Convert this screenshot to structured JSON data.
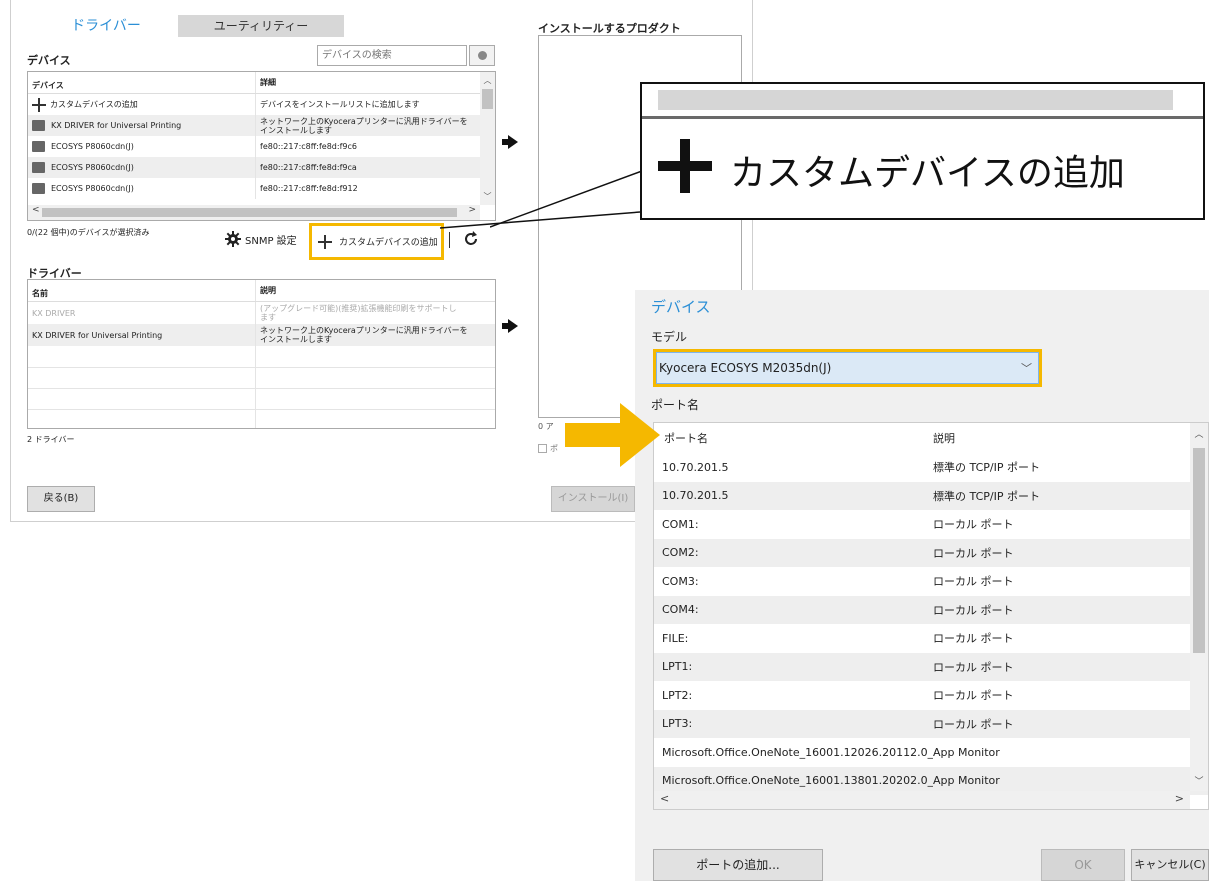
{
  "main": {
    "tabs": {
      "drivers": "ドライバー",
      "utility": "ユーティリティー"
    },
    "devices_title": "デバイス",
    "search_placeholder": "デバイスの検索",
    "device_grid": {
      "col_device": "デバイス",
      "col_detail": "詳細",
      "rows": [
        {
          "name": "カスタムデバイスの追加",
          "detail": "デバイスをインストールリストに追加します",
          "icon": "plus-icon"
        },
        {
          "name": "KX DRIVER for Universal Printing",
          "detail": "ネットワーク上のKyoceraプリンターに汎用ドライバーを\nインストールします",
          "icon": "folder-icon"
        },
        {
          "name": "ECOSYS P8060cdn(J)",
          "detail": "fe80::217:c8ff:fe8d:f9c6",
          "icon": "folder-icon"
        },
        {
          "name": "ECOSYS P8060cdn(J)",
          "detail": "fe80::217:c8ff:fe8d:f9ca",
          "icon": "folder-icon"
        },
        {
          "name": "ECOSYS P8060cdn(J)",
          "detail": "fe80::217:c8ff:fe8d:f912",
          "icon": "folder-icon"
        }
      ]
    },
    "selected_status": "0/(22 個中)のデバイスが選択済み",
    "snmp_label": "SNMP 設定",
    "add_custom_label": "カスタムデバイスの追加",
    "drivers_title": "ドライバー",
    "driver_grid": {
      "col_name": "名前",
      "col_desc": "説明",
      "rows": [
        {
          "name": "KX DRIVER",
          "desc": "(アップグレード可能)(推奨)拡張機能印刷をサポートし\nます",
          "muted": true
        },
        {
          "name": "KX DRIVER for Universal Printing",
          "desc": "ネットワーク上のKyoceraプリンターに汎用ドライバーを\nインストールします",
          "muted": false
        }
      ]
    },
    "driver_count": "2 ドライバー",
    "back_button": "戻る(B)",
    "install_products_title": "インストールするプロダクト",
    "install_button": "インストール(I)",
    "partial_count": "0 ア",
    "partial_checkbox": "ポ"
  },
  "callout": {
    "label": "カスタムデバイスの追加"
  },
  "dialog": {
    "title": "デバイス",
    "model_label": "モデル",
    "model_value": "Kyocera ECOSYS M2035dn(J)",
    "port_label": "ポート名",
    "col_port": "ポート名",
    "col_desc": "説明",
    "ports": [
      {
        "name": "10.70.201.5",
        "desc": "標準の TCP/IP ポート"
      },
      {
        "name": "10.70.201.5",
        "desc": "標準の TCP/IP ポート"
      },
      {
        "name": "COM1:",
        "desc": "ローカル ポート"
      },
      {
        "name": "COM2:",
        "desc": "ローカル ポート"
      },
      {
        "name": "COM3:",
        "desc": "ローカル ポート"
      },
      {
        "name": "COM4:",
        "desc": "ローカル ポート"
      },
      {
        "name": "FILE:",
        "desc": "ローカル ポート"
      },
      {
        "name": "LPT1:",
        "desc": "ローカル ポート"
      },
      {
        "name": "LPT2:",
        "desc": "ローカル ポート"
      },
      {
        "name": "LPT3:",
        "desc": "ローカル ポート"
      },
      {
        "name": "Microsoft.Office.OneNote_16001.12026.20112.0_...",
        "desc": "App Monitor"
      },
      {
        "name": "Microsoft.Office.OneNote_16001.13801.20202.0_...",
        "desc": "App Monitor"
      }
    ],
    "add_port_button": "ポートの追加...",
    "ok_button": "OK",
    "cancel_button": "キャンセル(C)"
  },
  "colors": {
    "accent": "#2b8fd6",
    "highlight": "#f5b800"
  }
}
